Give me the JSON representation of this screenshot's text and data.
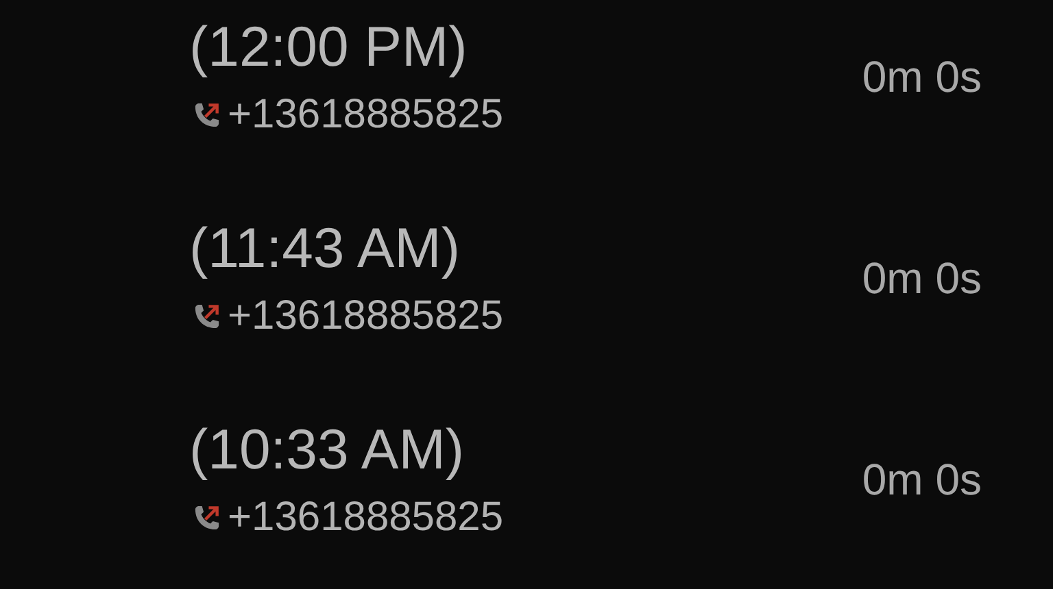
{
  "calls": [
    {
      "time": "(12:00 PM)",
      "number": "+13618885825",
      "kind": "outgoing",
      "duration": "0m 0s"
    },
    {
      "time": "(11:43 AM)",
      "number": "+13618885825",
      "kind": "outgoing",
      "duration": "0m 0s"
    },
    {
      "time": "(10:33 AM)",
      "number": "+13618885825",
      "kind": "outgoing",
      "duration": "0m 0s"
    }
  ]
}
